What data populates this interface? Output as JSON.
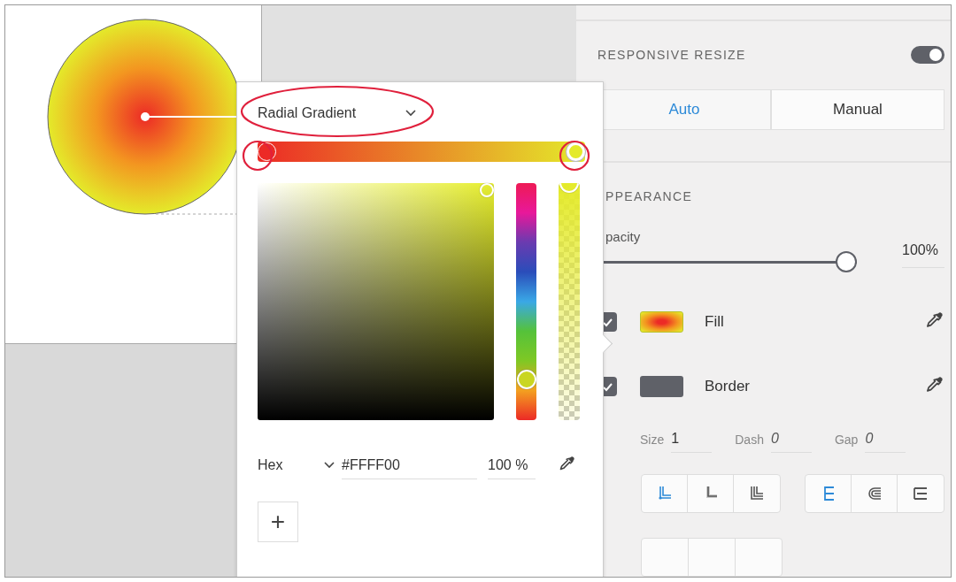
{
  "color_picker": {
    "gradient_type": "Radial Gradient",
    "gradient_stops": [
      {
        "color": "#ec2a26",
        "selected": false
      },
      {
        "color": "#e4ea2a",
        "selected": true
      }
    ],
    "hue": {
      "level": 0.17
    },
    "alpha": {
      "level": 1
    },
    "format": "Hex",
    "hex": "#FFFF00",
    "alpha_reading": "100 %",
    "add_button": "+"
  },
  "responsive_resize": {
    "label": "RESPONSIVE RESIZE",
    "on": true,
    "modes": [
      {
        "label": "Auto",
        "selected": true
      },
      {
        "label": "Manual",
        "selected": false
      }
    ]
  },
  "appearance": {
    "heading": "PPEARANCE",
    "opacity": {
      "label": "pacity",
      "level": 1,
      "reading": "100%"
    },
    "layers": [
      {
        "kind": "gradient",
        "label": "Fill",
        "checked": true
      },
      {
        "kind": "solid",
        "label": "Border",
        "checked": true,
        "color": "#5f6168"
      }
    ],
    "border_fields": [
      {
        "label": "Size",
        "value": "1"
      },
      {
        "label": "Dash",
        "placeholder": "0"
      },
      {
        "label": "Gap",
        "placeholder": "0"
      }
    ],
    "stroke_join": [
      {
        "selected": true
      },
      {
        "selected": false
      },
      {
        "selected": false
      }
    ],
    "stroke_align": [
      {
        "selected": true
      },
      {
        "selected": false
      },
      {
        "selected": false
      }
    ]
  }
}
